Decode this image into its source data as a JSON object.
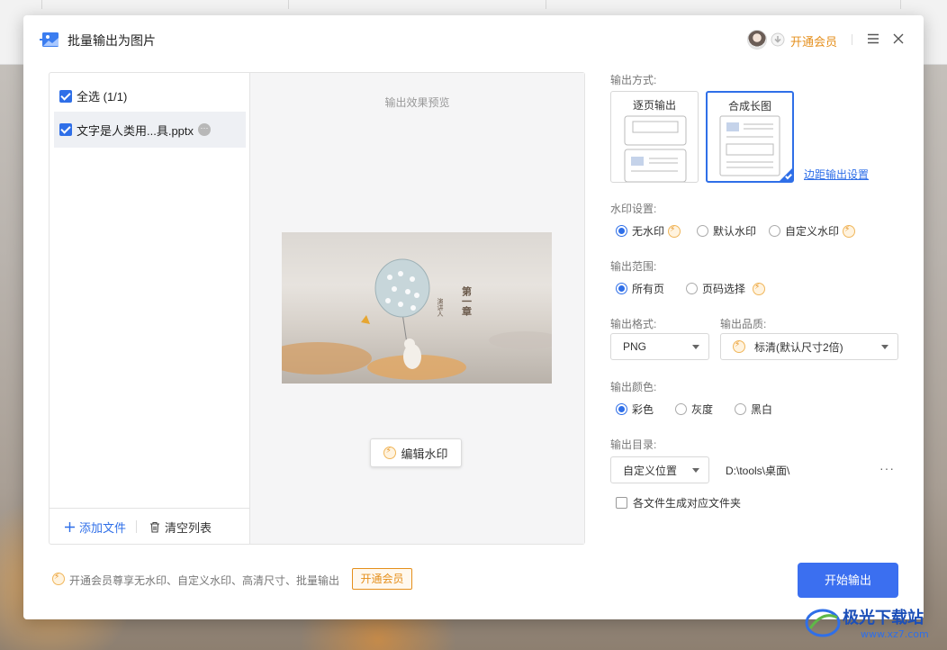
{
  "dialog": {
    "title": "批量输出为图片",
    "vip_label": "开通会员"
  },
  "file_list": {
    "select_all_label": "全选 (1/1)",
    "files": [
      {
        "name": "文字是人类用...具.pptx"
      }
    ],
    "add_file_label": "添加文件",
    "clear_list_label": "清空列表"
  },
  "preview": {
    "label": "输出效果预览",
    "slide_title": "第一章",
    "slide_subtitle": "演讲人",
    "edit_watermark_label": "编辑水印"
  },
  "output_mode": {
    "label": "输出方式:",
    "options": [
      "逐页输出",
      "合成长图"
    ],
    "selected": "合成长图",
    "margin_link": "边距输出设置"
  },
  "watermark": {
    "label": "水印设置:",
    "options": [
      "无水印",
      "默认水印",
      "自定义水印"
    ],
    "selected": "无水印"
  },
  "range": {
    "label": "输出范围:",
    "options": [
      "所有页",
      "页码选择"
    ],
    "selected": "所有页"
  },
  "format": {
    "label": "输出格式:",
    "value": "PNG"
  },
  "quality": {
    "label": "输出品质:",
    "value": "标清(默认尺寸2倍)"
  },
  "color": {
    "label": "输出颜色:",
    "options": [
      "彩色",
      "灰度",
      "黑白"
    ],
    "selected": "彩色"
  },
  "directory": {
    "label": "输出目录:",
    "mode_value": "自定义位置",
    "path": "D:\\tools\\桌面\\",
    "more": "···",
    "per_file_folder_label": "各文件生成对应文件夹"
  },
  "footer": {
    "promo_text": "开通会员尊享无水印、自定义水印、高清尺寸、批量输出",
    "vip_button": "开通会员",
    "start_button": "开始输出"
  },
  "site_watermark": {
    "name": "极光下载站",
    "url": "www.xz7.com"
  },
  "colors": {
    "accent": "#2f6fe8",
    "primary_button": "#3b6ff0",
    "vip_orange": "#e58f1c"
  }
}
